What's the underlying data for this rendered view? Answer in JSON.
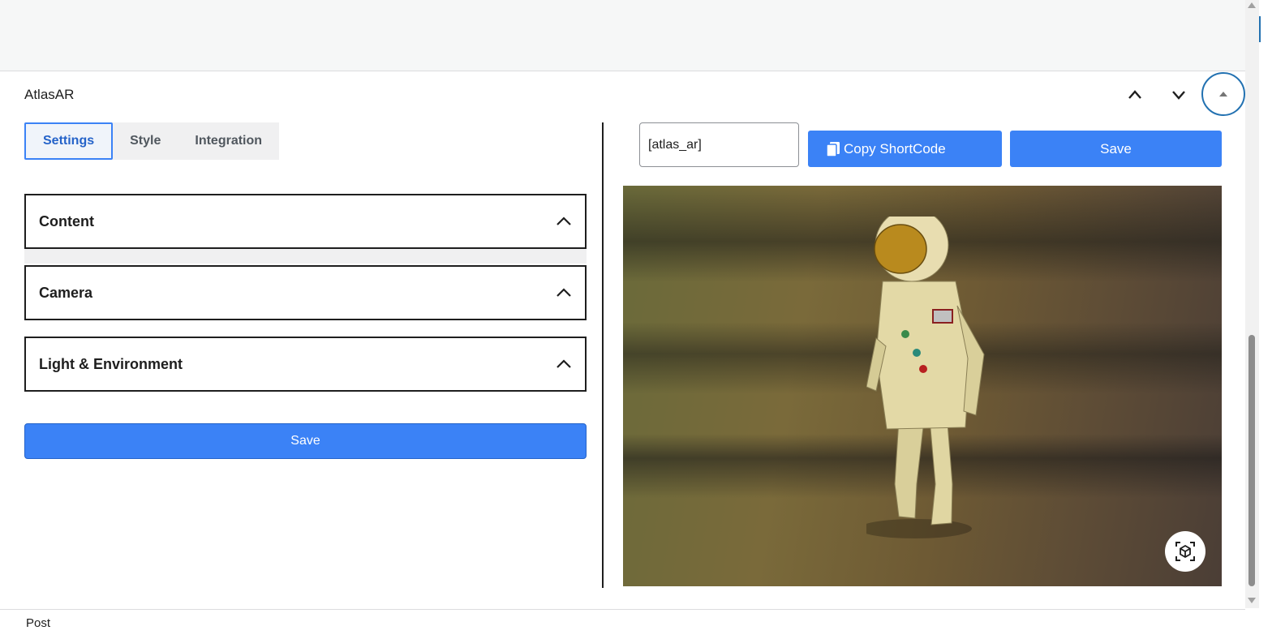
{
  "panel": {
    "title": "AtlasAR"
  },
  "tabs": [
    {
      "label": "Settings",
      "active": true
    },
    {
      "label": "Style",
      "active": false
    },
    {
      "label": "Integration",
      "active": false
    }
  ],
  "accordions": [
    {
      "label": "Content"
    },
    {
      "label": "Camera"
    },
    {
      "label": "Light & Environment"
    }
  ],
  "settings_save_label": "Save",
  "shortcode": {
    "value": "[atlas_ar]",
    "copy_label": "Copy ShortCode",
    "save_label": "Save"
  },
  "viewer": {
    "ar_button_icon": "ar-cube-icon"
  },
  "footer": {
    "label": "Post"
  },
  "colors": {
    "accent": "#3b82f6",
    "admin_blue": "#2271b1"
  }
}
